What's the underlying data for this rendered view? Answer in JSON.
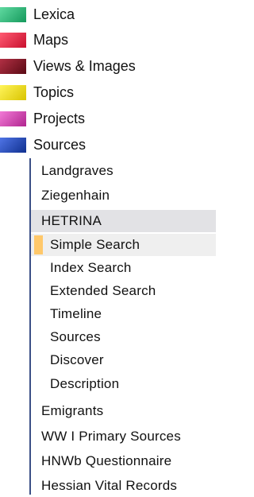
{
  "nav": {
    "top_items": [
      {
        "label": "Lexica",
        "color": "#2bbf7a"
      },
      {
        "label": "Maps",
        "color": "#e81b3a"
      },
      {
        "label": "Views & Images",
        "color": "#7a1420"
      },
      {
        "label": "Topics",
        "color": "#f2e010"
      },
      {
        "label": "Projects",
        "color": "#d63fb3"
      },
      {
        "label": "Sources",
        "color": "#1f45b3"
      }
    ],
    "sources_children": [
      {
        "label": "Landgraves"
      },
      {
        "label": "Ziegenhain"
      },
      {
        "label": "HETRINA"
      },
      {
        "label": "Emigrants"
      },
      {
        "label": "WW I Primary Sources"
      },
      {
        "label": "HNWb Questionnaire"
      },
      {
        "label": "Hessian Vital Records"
      }
    ],
    "hetrina_children": [
      {
        "label": "Simple Search",
        "active": true
      },
      {
        "label": "Index Search"
      },
      {
        "label": "Extended Search"
      },
      {
        "label": "Timeline"
      },
      {
        "label": "Sources"
      },
      {
        "label": "Discover"
      },
      {
        "label": "Description"
      }
    ],
    "active_marker_color": "#ffc86a",
    "tree_line_color": "#3b4f86"
  }
}
